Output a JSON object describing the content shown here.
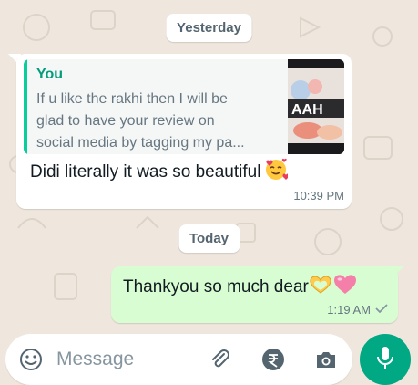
{
  "colors": {
    "wallpaper": "#efe7dd",
    "incoming_bubble": "#ffffff",
    "outgoing_bubble": "#d9fdd3",
    "accent": "#00a884",
    "quote_author": "#029d7a",
    "meta_text": "#667781"
  },
  "chat": {
    "date_yesterday": "Yesterday",
    "date_today": "Today",
    "messages": [
      {
        "direction": "incoming",
        "quoted": {
          "author": "You",
          "text_lines": [
            "If u like the rakhi then I will be",
            "glad to have your review on",
            "social media by tagging my pa..."
          ],
          "thumbnail_icon": "rakhi-photo-thumbnail"
        },
        "text": "Didi literally it was so beautiful",
        "emoji": "smiling-face-with-hearts",
        "time": "10:39 PM"
      },
      {
        "direction": "outgoing",
        "text": "Thankyou so much dear",
        "emojis": [
          "heart-hands",
          "pink-heart"
        ],
        "time": "1:19 AM",
        "status_icon": "single-check-icon"
      }
    ]
  },
  "composer": {
    "placeholder": "Message",
    "icons": [
      "emoji-icon",
      "attach-icon",
      "rupee-payment-icon",
      "camera-icon",
      "mic-icon"
    ]
  }
}
